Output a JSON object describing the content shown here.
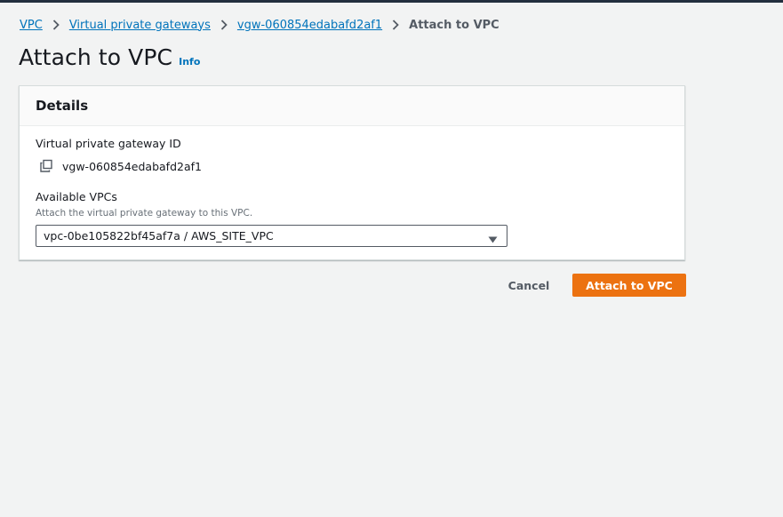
{
  "breadcrumb": {
    "items": [
      {
        "label": "VPC"
      },
      {
        "label": "Virtual private gateways"
      },
      {
        "label": "vgw-060854edabafd2af1"
      }
    ],
    "current": "Attach to VPC"
  },
  "page": {
    "title": "Attach to VPC",
    "info_label": "Info"
  },
  "details": {
    "header": "Details",
    "gateway_id_label": "Virtual private gateway ID",
    "gateway_id_value": "vgw-060854edabafd2af1",
    "vpcs_label": "Available VPCs",
    "vpcs_description": "Attach the virtual private gateway to this VPC.",
    "vpcs_selected": "vpc-0be105822bf45af7a / AWS_SITE_VPC"
  },
  "actions": {
    "cancel_label": "Cancel",
    "submit_label": "Attach to VPC"
  },
  "icons": {
    "separator": "chevron-right-icon",
    "copy": "copy-icon",
    "dropdown": "caret-down-icon"
  },
  "colors": {
    "link": "#0073bb",
    "primary_button": "#ec7211",
    "background": "#f2f3f3",
    "top_bar": "#232f3e"
  }
}
